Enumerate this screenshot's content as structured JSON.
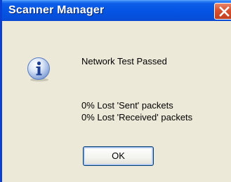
{
  "window": {
    "title": "Scanner Manager"
  },
  "icons": {
    "message_icon": "information-icon",
    "close_icon": "close-icon"
  },
  "message": {
    "heading": "Network Test Passed",
    "sent_line": "0% Lost 'Sent' packets",
    "received_line": "0% Lost 'Received' packets"
  },
  "buttons": {
    "ok_label": "OK"
  },
  "colors": {
    "titlebar": "#0554e3",
    "close_button": "#d8502f",
    "dialog_background": "#ece9d8"
  }
}
